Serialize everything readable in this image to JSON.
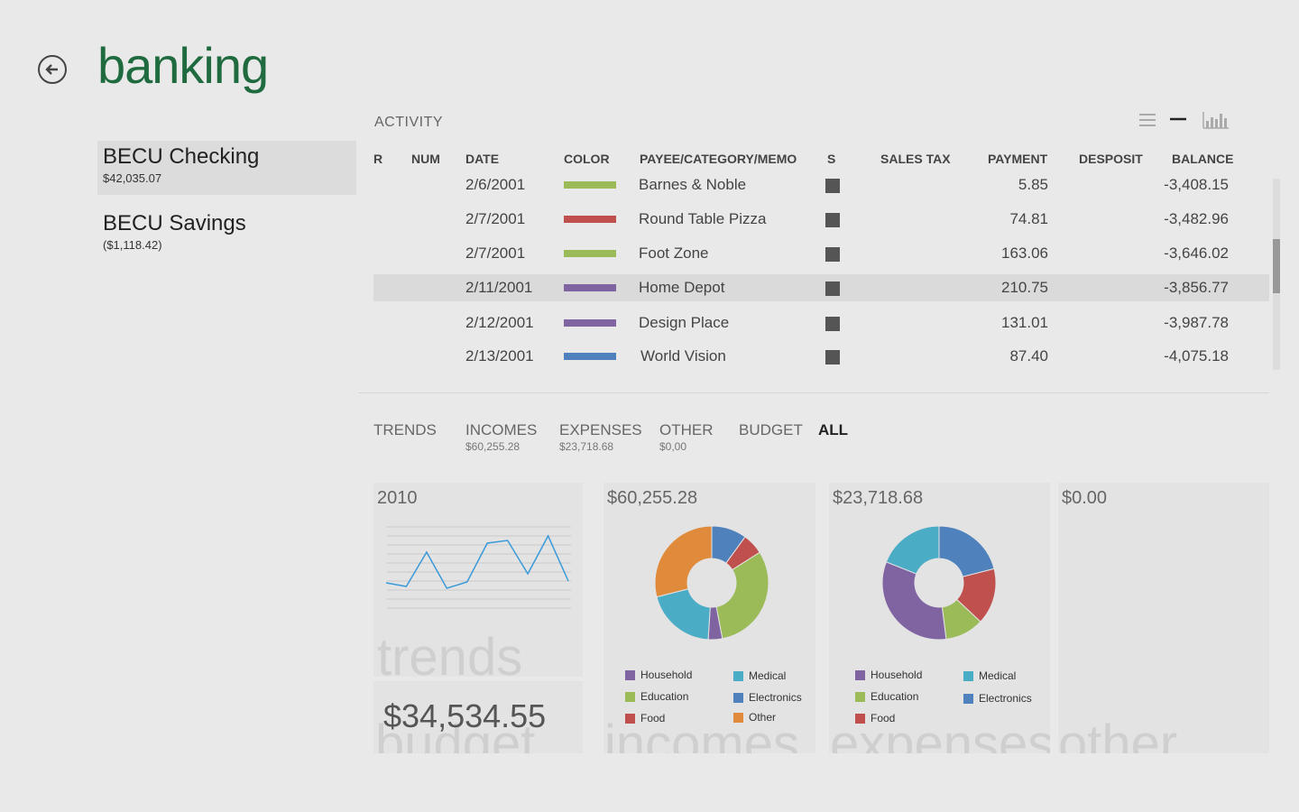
{
  "header": {
    "title": "banking",
    "back_icon": "back-arrow-icon"
  },
  "accounts": [
    {
      "name": "BECU Checking",
      "balance": "$42,035.07",
      "selected": true
    },
    {
      "name": "BECU Savings",
      "balance": "($1,118.42)",
      "selected": false
    }
  ],
  "activity": {
    "label": "ACTIVITY",
    "view_icons": [
      "list-view-icon",
      "compact-view-icon",
      "chart-view-icon"
    ],
    "columns": {
      "r": "R",
      "num": "NUM",
      "date": "DATE",
      "color": "COLOR",
      "payee": "PAYEE/CATEGORY/MEMO",
      "s": "S",
      "sales_tax": "SALES TAX",
      "payment": "PAYMENT",
      "deposit": "DESPOSIT",
      "balance": "BALANCE"
    },
    "rows": [
      {
        "date": "2/6/2001",
        "color": "#9bbb59",
        "payee": "Barnes & Noble",
        "payment": "5.85",
        "balance": "-3,408.15"
      },
      {
        "date": "2/7/2001",
        "color": "#c0504d",
        "payee": "Round Table Pizza",
        "payment": "74.81",
        "balance": "-3,482.96"
      },
      {
        "date": "2/7/2001",
        "color": "#9bbb59",
        "payee": "Foot Zone",
        "payment": "163.06",
        "balance": "-3,646.02"
      },
      {
        "date": "2/11/2001",
        "color": "#8064a2",
        "payee": "Home Depot",
        "payment": "210.75",
        "balance": "-3,856.77"
      },
      {
        "date": "2/12/2001",
        "color": "#8064a2",
        "payee": "Design Place",
        "payment": "131.01",
        "balance": "-3,987.78"
      },
      {
        "date": "2/13/2001",
        "color": "#4f81bd",
        "payee": "World Vision",
        "payment": "87.40",
        "balance": "-4,075.18"
      }
    ],
    "selected_row": 3
  },
  "trends": {
    "label": "TRENDS",
    "tabs": [
      {
        "label": "INCOMES",
        "sub": "$60,255.28"
      },
      {
        "label": "EXPENSES",
        "sub": "$23,718.68"
      },
      {
        "label": "OTHER",
        "sub": "$0,00"
      },
      {
        "label": "BUDGET",
        "sub": ""
      },
      {
        "label": "ALL",
        "sub": "",
        "active": true
      }
    ]
  },
  "tiles": {
    "trends": {
      "heading": "2010",
      "watermark": "trends"
    },
    "budget": {
      "amount": "$34,534.55",
      "watermark": "budget"
    },
    "incomes": {
      "heading": "$60,255.28",
      "watermark": "incomes"
    },
    "expenses": {
      "heading": "$23,718.68",
      "watermark": "expenses"
    },
    "other": {
      "heading": "$0.00",
      "watermark": "other"
    }
  },
  "colors": {
    "household": "#8064a2",
    "medical": "#4bacc6",
    "education": "#9bbb59",
    "electronics": "#4f81bd",
    "food": "#c0504d",
    "other": "#e08a3c",
    "title_green": "#1f6b3f",
    "trend_line": "#3a9ad9"
  },
  "chart_data": [
    {
      "type": "line",
      "title": "2010",
      "series": [
        {
          "values": [
            3,
            2.6,
            6.4,
            2.4,
            3.1,
            7.4,
            7.7,
            4,
            8.2,
            3.2
          ]
        }
      ],
      "grid": true
    },
    {
      "type": "pie",
      "title": "$60,255.28",
      "categories": [
        "Electronics",
        "Food",
        "Education",
        "Household",
        "Medical",
        "Other"
      ],
      "values": [
        10,
        6,
        31,
        4,
        20,
        29
      ],
      "legend": [
        "Household",
        "Medical",
        "Education",
        "Electronics",
        "Food",
        "Other"
      ]
    },
    {
      "type": "pie",
      "title": "$23,718.68",
      "categories": [
        "Electronics",
        "Food",
        "Education",
        "Household",
        "Medical"
      ],
      "values": [
        21,
        16,
        11,
        33,
        19
      ],
      "legend": [
        "Household",
        "Medical",
        "Education",
        "Electronics",
        "Food"
      ]
    }
  ]
}
